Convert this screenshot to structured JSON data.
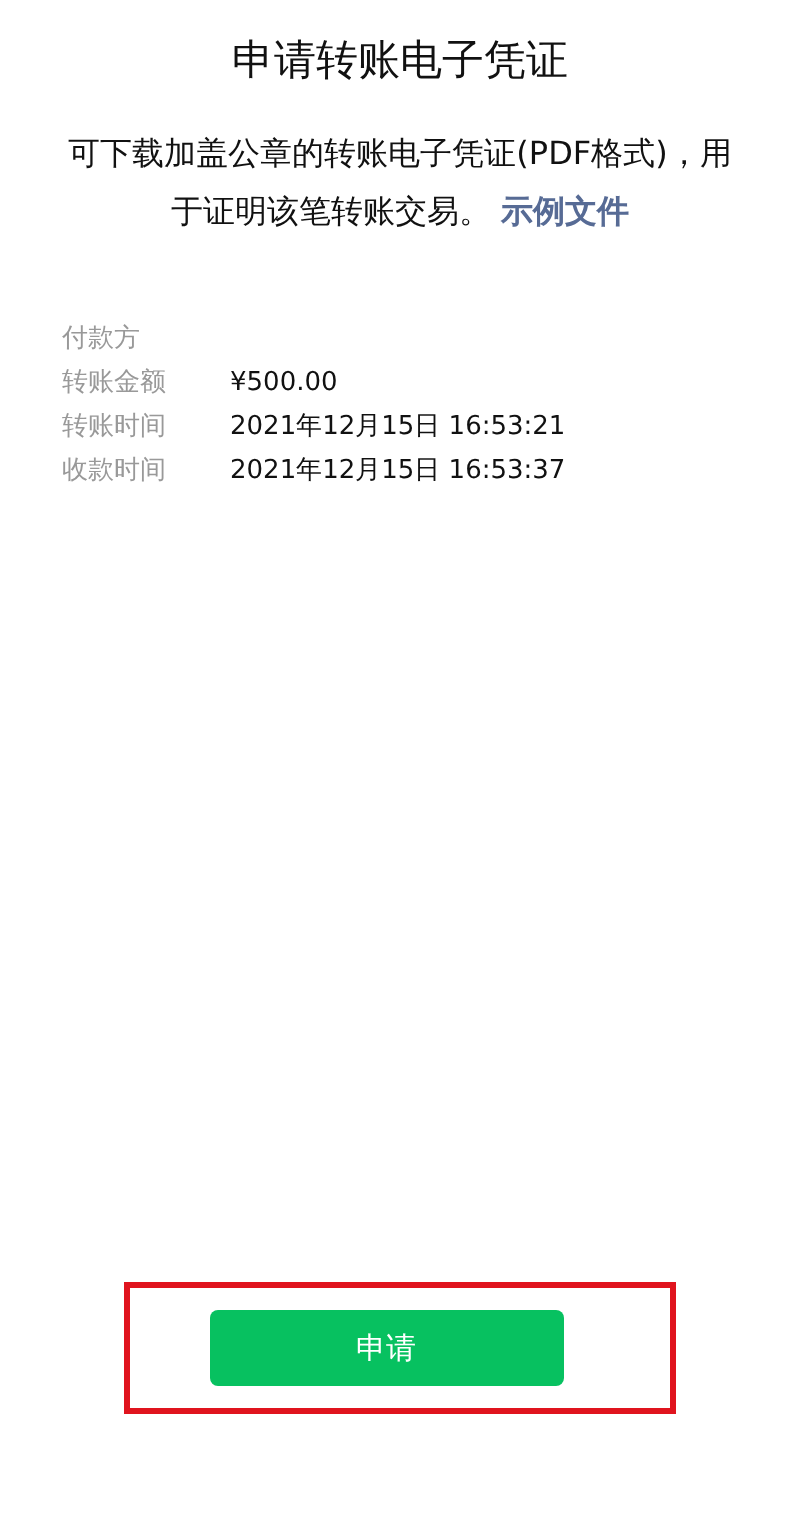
{
  "title": "申请转账电子凭证",
  "description": {
    "text": "可下载加盖公章的转账电子凭证(PDF格式)，用于证明该笔转账交易。",
    "link": "示例文件"
  },
  "details": [
    {
      "label": "付款方"
    },
    {
      "label": "转账金额",
      "value": "¥500.00"
    },
    {
      "label": "转账时间",
      "value": "2021年12月15日 16:53:21"
    },
    {
      "label": "收款时间",
      "value": "2021年12月15日 16:53:37"
    }
  ],
  "apply_button": {
    "label": "申请",
    "highlighted": true
  }
}
